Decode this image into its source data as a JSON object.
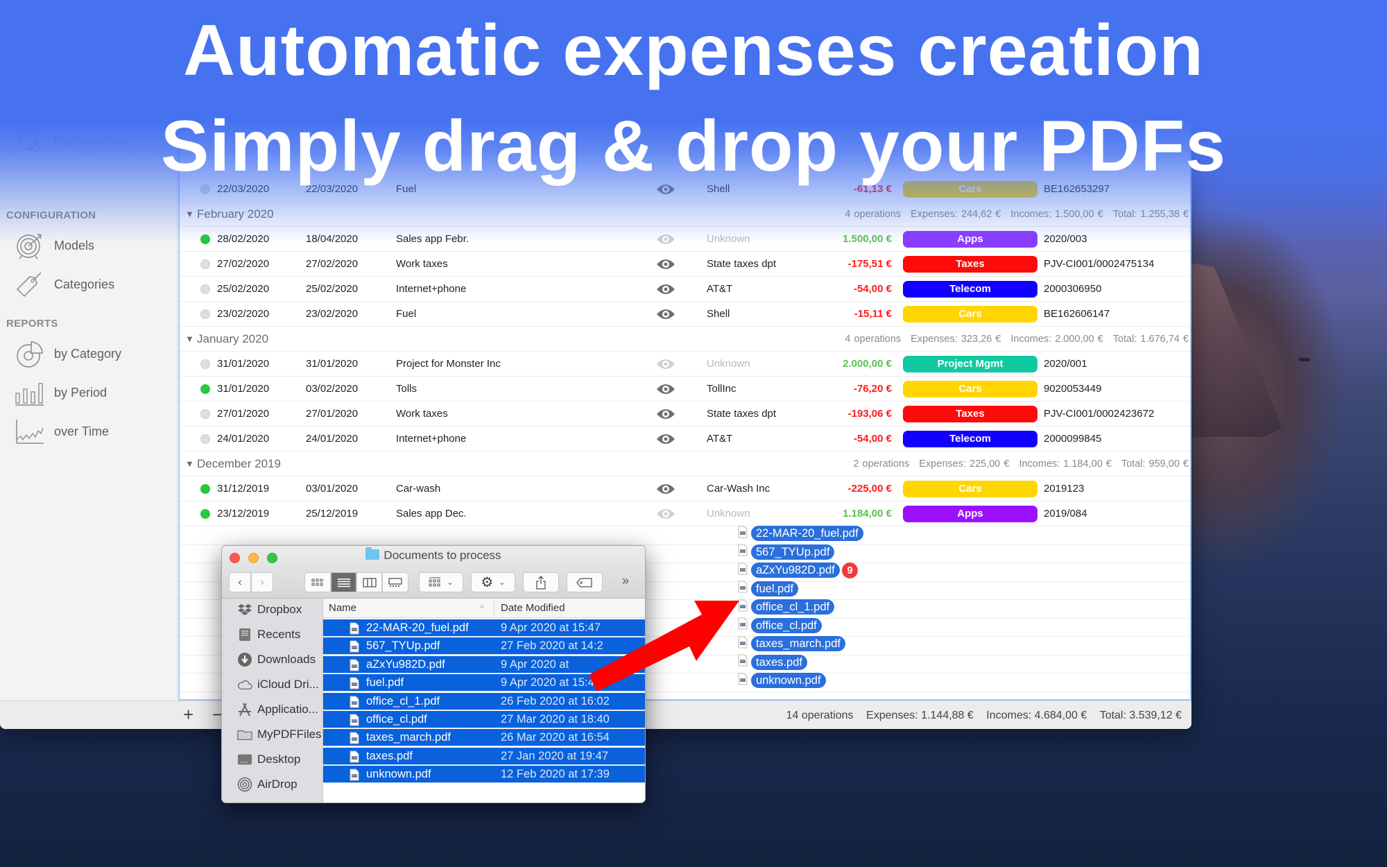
{
  "headline": {
    "line1": "Automatic expenses creation",
    "line2": "Simply drag & drop your PDFs"
  },
  "colors": {
    "banner_blue": "#4672f0",
    "negative_amount": "#ff1a1a",
    "positive_amount": "#5cc04f",
    "selection_blue": "#0961dc",
    "drag_pill_blue": "#2a6fdb",
    "arrow_red": "#ff0000",
    "badge_red": "#f23a3a"
  },
  "sidebar": {
    "last_modified_label": "Last modified",
    "configuration_header": "CONFIGURATION",
    "configuration_items": [
      {
        "label": "Models",
        "icon": "target-icon"
      },
      {
        "label": "Categories",
        "icon": "tag-icon"
      }
    ],
    "reports_header": "REPORTS",
    "reports_items": [
      {
        "label": "by Category",
        "icon": "pie-chart-icon"
      },
      {
        "label": "by Period",
        "icon": "bar-chart-icon"
      },
      {
        "label": "over Time",
        "icon": "line-chart-icon"
      }
    ]
  },
  "table": {
    "partial_row": {
      "status": "grey",
      "date": "22/03/2020",
      "due": "22/03/2020",
      "description": "Fuel",
      "payee": "Shell",
      "amount": "-61,13 €",
      "category": "Cars",
      "category_color": "#ffd600",
      "reference": "BE162653297"
    },
    "groups": [
      {
        "title": "February 2020",
        "operations": "4 operations",
        "expenses": "Expenses: 244,62 €",
        "incomes": "Incomes: 1.500,00 €",
        "total": "Total: 1.255,38 €",
        "rows": [
          {
            "status": "green",
            "date": "28/02/2020",
            "due": "18/04/2020",
            "description": "Sales app Febr.",
            "payee": "Unknown",
            "payee_known": false,
            "amount": "1.500,00 €",
            "sign": "pos",
            "category": "Apps",
            "category_color": "#8a3cff",
            "reference": "2020/003"
          },
          {
            "status": "grey",
            "date": "27/02/2020",
            "due": "27/02/2020",
            "description": "Work taxes",
            "payee": "State taxes dpt",
            "payee_known": true,
            "amount": "-175,51 €",
            "sign": "neg",
            "category": "Taxes",
            "category_color": "#ff0a0a",
            "reference": "PJV-CI001/0002475134"
          },
          {
            "status": "grey",
            "date": "25/02/2020",
            "due": "25/02/2020",
            "description": "Internet+phone",
            "payee": "AT&T",
            "payee_known": true,
            "amount": "-54,00 €",
            "sign": "neg",
            "category": "Telecom",
            "category_color": "#1200ff",
            "reference": "2000306950"
          },
          {
            "status": "grey",
            "date": "23/02/2020",
            "due": "23/02/2020",
            "description": "Fuel",
            "payee": "Shell",
            "payee_known": true,
            "amount": "-15,11 €",
            "sign": "neg",
            "category": "Cars",
            "category_color": "#ffd600",
            "reference": "BE162606147"
          }
        ]
      },
      {
        "title": "January 2020",
        "operations": "4 operations",
        "expenses": "Expenses: 323,26 €",
        "incomes": "Incomes: 2.000,00 €",
        "total": "Total: 1.676,74 €",
        "rows": [
          {
            "status": "grey",
            "date": "31/01/2020",
            "due": "31/01/2020",
            "description": "Project for Monster Inc",
            "payee": "Unknown",
            "payee_known": false,
            "amount": "2.000,00 €",
            "sign": "pos",
            "category": "Project Mgmt",
            "category_color": "#10c9a0",
            "reference": "2020/001"
          },
          {
            "status": "green",
            "date": "31/01/2020",
            "due": "03/02/2020",
            "description": "Tolls",
            "payee": "TollInc",
            "payee_known": true,
            "amount": "-76,20 €",
            "sign": "neg",
            "category": "Cars",
            "category_color": "#ffd600",
            "reference": "9020053449"
          },
          {
            "status": "grey",
            "date": "27/01/2020",
            "due": "27/01/2020",
            "description": "Work taxes",
            "payee": "State taxes dpt",
            "payee_known": true,
            "amount": "-193,06 €",
            "sign": "neg",
            "category": "Taxes",
            "category_color": "#ff0a0a",
            "reference": "PJV-CI001/0002423672"
          },
          {
            "status": "grey",
            "date": "24/01/2020",
            "due": "24/01/2020",
            "description": "Internet+phone",
            "payee": "AT&T",
            "payee_known": true,
            "amount": "-54,00 €",
            "sign": "neg",
            "category": "Telecom",
            "category_color": "#1200ff",
            "reference": "2000099845"
          }
        ]
      },
      {
        "title": "December 2019",
        "operations": "2 operations",
        "expenses": "Expenses: 225,00 €",
        "incomes": "Incomes: 1.184,00 €",
        "total": "Total: 959,00 €",
        "rows": [
          {
            "status": "green",
            "date": "31/12/2019",
            "due": "03/01/2020",
            "description": "Car-wash",
            "payee": "Car-Wash Inc",
            "payee_known": true,
            "amount": "-225,00 €",
            "sign": "neg",
            "category": "Cars",
            "category_color": "#ffd600",
            "reference": "2019123"
          },
          {
            "status": "green",
            "date": "23/12/2019",
            "due": "25/12/2019",
            "description": "Sales app Dec.",
            "payee": "Unknown",
            "payee_known": false,
            "amount": "1.184,00 €",
            "sign": "pos",
            "category": "Apps",
            "category_color": "#9a10ff",
            "reference": "2019/084"
          }
        ]
      }
    ]
  },
  "footer": {
    "add_label": "+",
    "remove_label": "−",
    "operations": "14 operations",
    "expenses": "Expenses: 1.144,88 €",
    "incomes": "Incomes: 4.684,00 €",
    "total": "Total: 3.539,12 €"
  },
  "finder": {
    "title": "Documents to process",
    "more_label": "»",
    "sidebar": [
      {
        "label": "Dropbox",
        "icon": "dropbox-icon"
      },
      {
        "label": "Recents",
        "icon": "recents-icon"
      },
      {
        "label": "Downloads",
        "icon": "downloads-icon"
      },
      {
        "label": "iCloud Dri...",
        "icon": "icloud-icon"
      },
      {
        "label": "Applicatio...",
        "icon": "applications-icon"
      },
      {
        "label": "MyPDFFiles",
        "icon": "folder-icon"
      },
      {
        "label": "Desktop",
        "icon": "desktop-icon"
      },
      {
        "label": "AirDrop",
        "icon": "airdrop-icon"
      }
    ],
    "columns": {
      "name": "Name",
      "date": "Date Modified"
    },
    "files": [
      {
        "name": "22-MAR-20_fuel.pdf",
        "date": "9 Apr 2020 at 15:47"
      },
      {
        "name": "567_TYUp.pdf",
        "date": "27 Feb 2020 at 14:2"
      },
      {
        "name": "aZxYu982D.pdf",
        "date": "9 Apr 2020 at"
      },
      {
        "name": "fuel.pdf",
        "date": "9 Apr 2020 at 15:47"
      },
      {
        "name": "office_cl_1.pdf",
        "date": "26 Feb 2020 at 16:02"
      },
      {
        "name": "office_cl.pdf",
        "date": "27 Mar 2020 at 18:40"
      },
      {
        "name": "taxes_march.pdf",
        "date": "26 Mar 2020 at 16:54"
      },
      {
        "name": "taxes.pdf",
        "date": "27 Jan 2020 at 19:47"
      },
      {
        "name": "unknown.pdf",
        "date": "12 Feb 2020 at 17:39"
      }
    ]
  },
  "drag": {
    "count_badge": "9",
    "items": [
      "22-MAR-20_fuel.pdf",
      "567_TYUp.pdf",
      "aZxYu982D.pdf",
      "fuel.pdf",
      "office_cl_1.pdf",
      "office_cl.pdf",
      "taxes_march.pdf",
      "taxes.pdf",
      "unknown.pdf"
    ]
  }
}
